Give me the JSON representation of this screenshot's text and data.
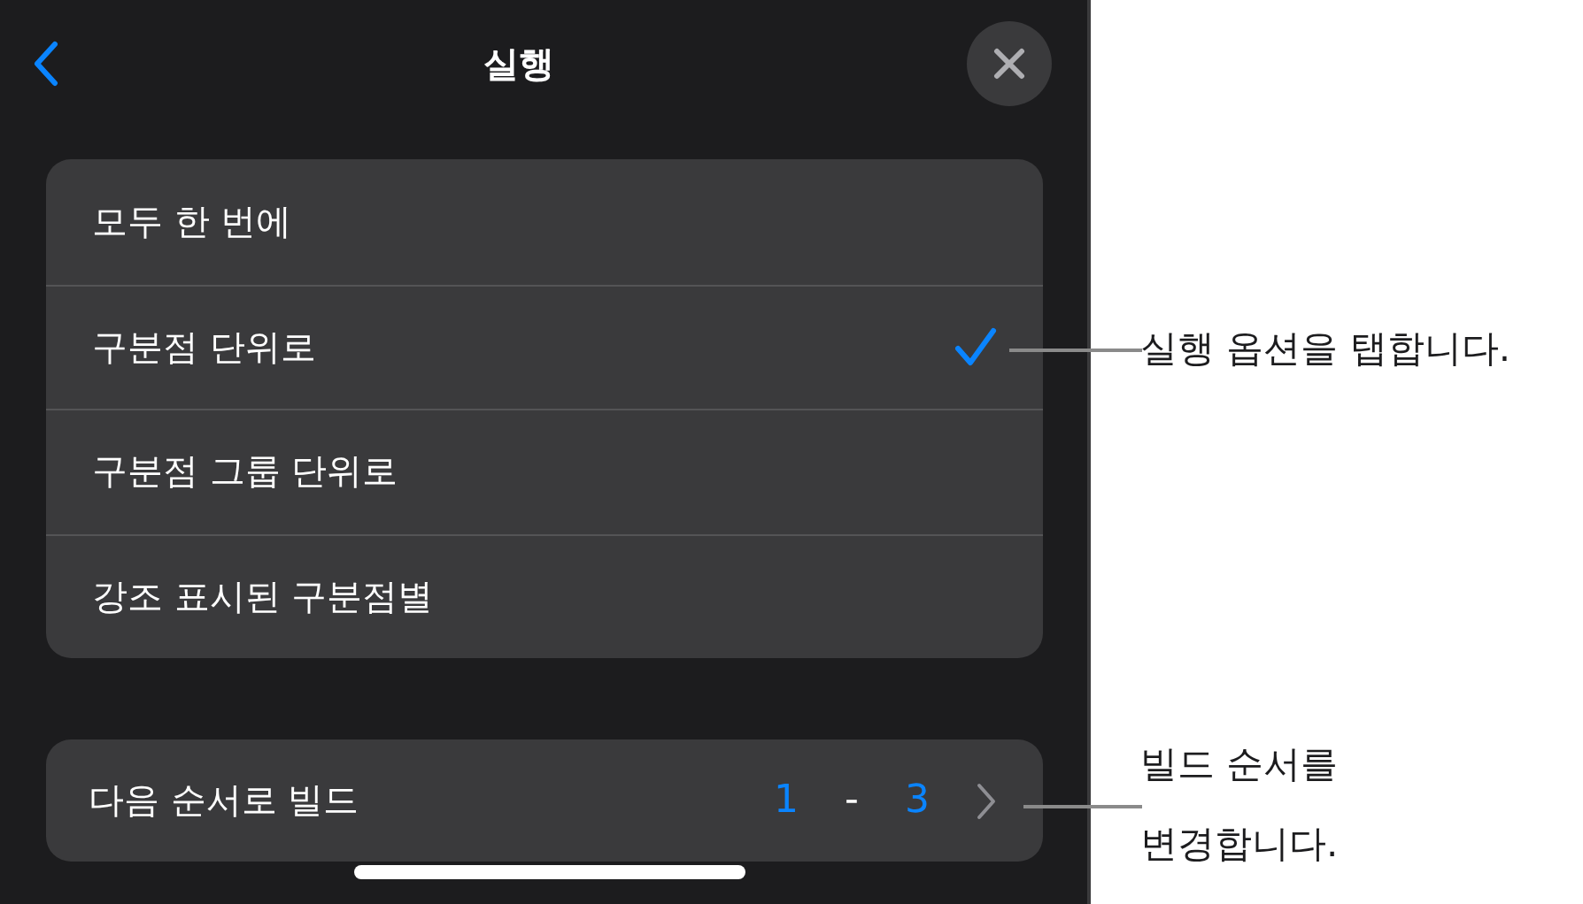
{
  "header": {
    "title": "실행"
  },
  "options": [
    {
      "label": "모두 한 번에",
      "selected": false
    },
    {
      "label": "구분점 단위로",
      "selected": true
    },
    {
      "label": "구분점 그룹 단위로",
      "selected": false
    },
    {
      "label": "강조 표시된 구분점별",
      "selected": false
    }
  ],
  "build_order": {
    "label": "다음 순서로 빌드",
    "from": "1",
    "separator": "-",
    "to": "3"
  },
  "callouts": [
    {
      "text": "실행 옵션을 탭합니다."
    },
    {
      "text": "빌드 순서를 변경합니다."
    }
  ]
}
